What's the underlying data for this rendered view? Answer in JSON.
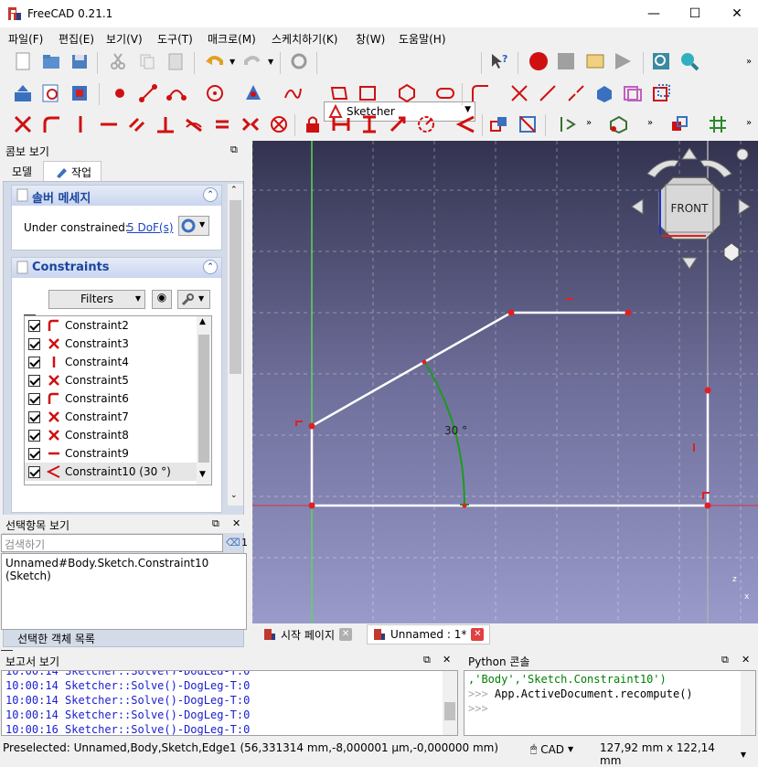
{
  "window": {
    "title": "FreeCAD 0.21.1",
    "minimize": "—",
    "maximize": "☐",
    "close": "✕"
  },
  "menu": [
    "파일(F)",
    "편집(E)",
    "보기(V)",
    "도구(T)",
    "매크로(M)",
    "스케치하기(K)",
    "창(W)",
    "도움말(H)"
  ],
  "workbench": "Sketcher",
  "combo_view": {
    "title": "콤보 보기",
    "tabs": [
      "모델",
      "작업"
    ],
    "solver": {
      "title": "솔버 메세지",
      "status_label": "Under constrained:",
      "dof_link": "5 DoF(s)"
    },
    "constraints": {
      "title": "Constraints",
      "filter_label": "Filters",
      "items": [
        {
          "label": "Constraint2",
          "icon": "coincident-tangent-icon"
        },
        {
          "label": "Constraint3",
          "icon": "coincident-icon"
        },
        {
          "label": "Constraint4",
          "icon": "vertical-icon"
        },
        {
          "label": "Constraint5",
          "icon": "coincident-icon"
        },
        {
          "label": "Constraint6",
          "icon": "coincident-tangent-icon"
        },
        {
          "label": "Constraint7",
          "icon": "coincident-icon"
        },
        {
          "label": "Constraint8",
          "icon": "coincident-icon"
        },
        {
          "label": "Constraint9",
          "icon": "horizontal-icon"
        },
        {
          "label": "Constraint10 (30 °)",
          "icon": "angle-icon"
        }
      ]
    }
  },
  "selection_view": {
    "title": "선택항목 보기",
    "search_placeholder": "검색하기",
    "count": "1",
    "selected": "Unnamed#Body.Sketch.Constraint10 (Sketch)",
    "list_checkbox": "선택한 객체 목록"
  },
  "viewport": {
    "navcube_face": "FRONT",
    "angle_label": "30 °",
    "axis_z": "z",
    "axis_x": "x"
  },
  "doc_tabs": [
    {
      "label": "시작 페이지"
    },
    {
      "label": "Unnamed : 1*"
    }
  ],
  "report_view": {
    "title": "보고서 보기",
    "lines": [
      "10:00:14  Sketcher::Solve()-DogLeg-T:0",
      "10:00:14  Sketcher::Solve()-DogLeg-T:0",
      "10:00:14  Sketcher::Solve()-DogLeg-T:0",
      "10:00:16  Sketcher::Solve()-DogLeg-T:0"
    ]
  },
  "python_console": {
    "title": "Python 콘솔",
    "line1": ",'Body','Sketch.Constraint10')",
    "line2_prompt": ">>> ",
    "line2_code": "App.ActiveDocument.recompute()",
    "line3_prompt": ">>> "
  },
  "statusbar": {
    "preselected": "Preselected: Unnamed,Body,Sketch,Edge1 (56,331314 mm,-8,000001 µm,-0,000000 mm)",
    "nav_style": "CAD",
    "dimensions": "127,92 mm x 122,14 mm"
  },
  "colors": {
    "sketch_red": "#e02020",
    "accent_blue": "#1a45a0",
    "constraint_green": "#1a9c1a"
  }
}
